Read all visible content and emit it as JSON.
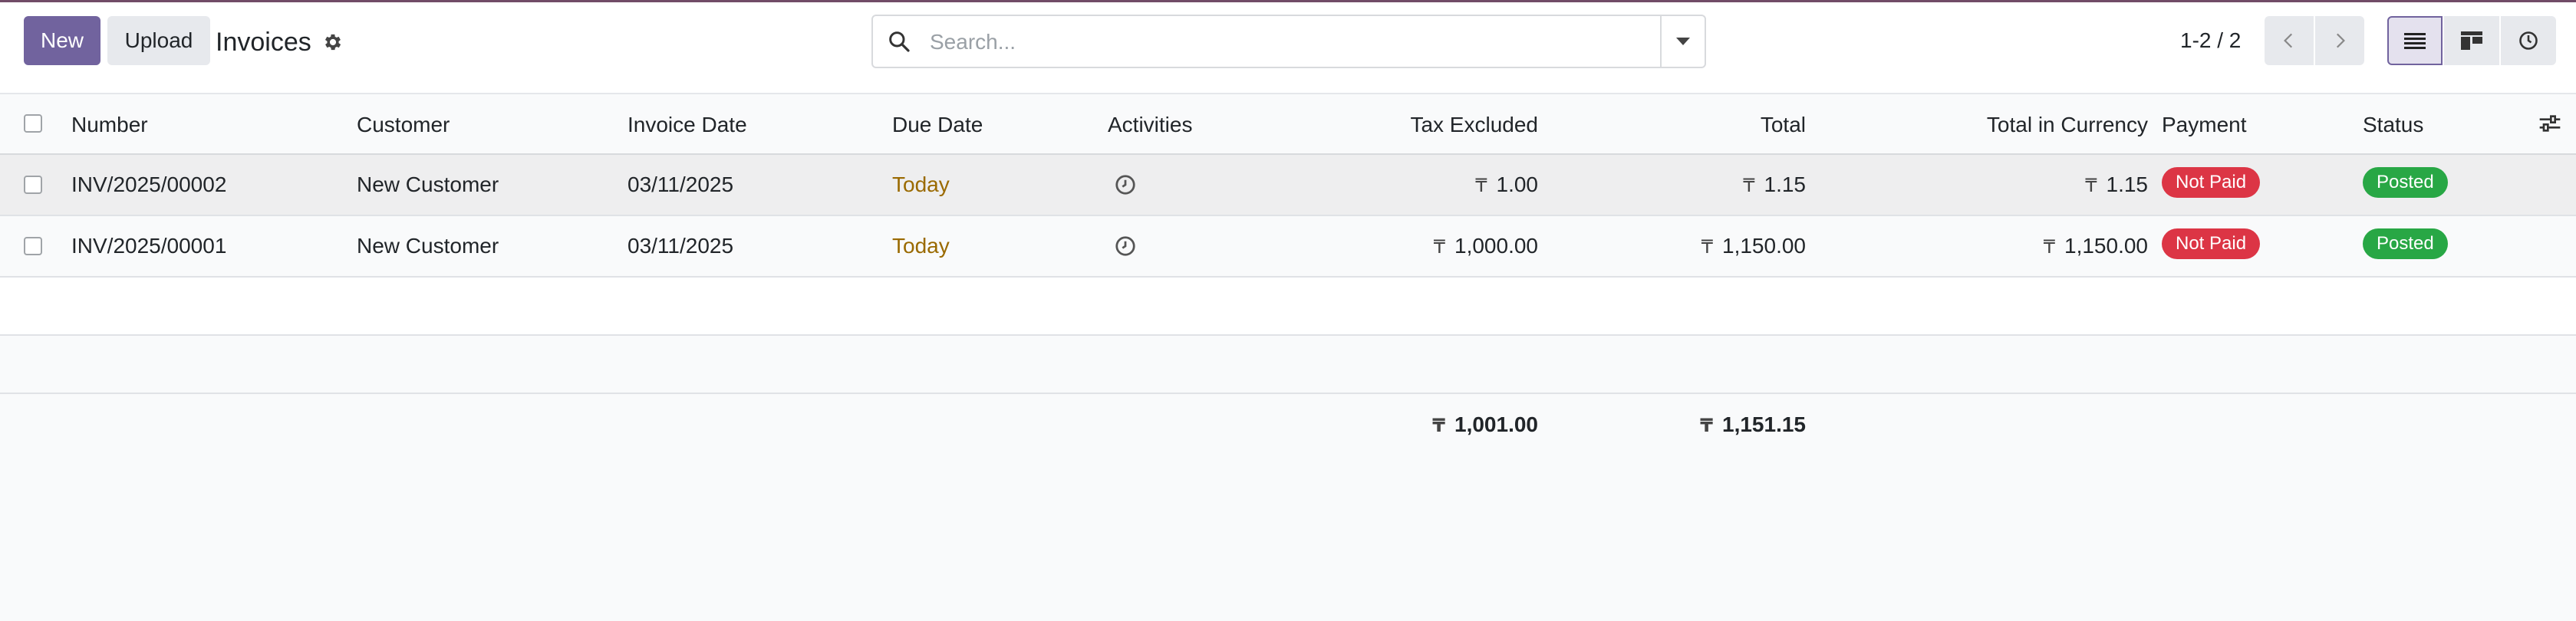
{
  "control_panel": {
    "new_label": "New",
    "upload_label": "Upload",
    "title": "Invoices",
    "search_placeholder": "Search...",
    "pager_value": "1-2 / 2"
  },
  "table": {
    "columns": {
      "number": "Number",
      "customer": "Customer",
      "invoice_date": "Invoice Date",
      "due_date": "Due Date",
      "activities": "Activities",
      "tax_excluded": "Tax Excluded",
      "total": "Total",
      "total_in_currency": "Total in Currency",
      "payment": "Payment",
      "status": "Status"
    },
    "rows": [
      {
        "number": "INV/2025/00002",
        "customer": "New Customer",
        "invoice_date": "03/11/2025",
        "due_date": "Today",
        "tax_excluded": "1.00",
        "total": "1.15",
        "total_in_currency": "1.15",
        "payment": "Not Paid",
        "status": "Posted"
      },
      {
        "number": "INV/2025/00001",
        "customer": "New Customer",
        "invoice_date": "03/11/2025",
        "due_date": "Today",
        "tax_excluded": "1,000.00",
        "total": "1,150.00",
        "total_in_currency": "1,150.00",
        "payment": "Not Paid",
        "status": "Posted"
      }
    ],
    "totals": {
      "tax_excluded": "1,001.00",
      "total": "1,151.15"
    },
    "currency_symbol": "₸"
  },
  "colors": {
    "brand": "#71639e",
    "not_paid": "#dc3545",
    "posted": "#28a745",
    "due_today": "#9a6a00"
  },
  "icons": {
    "gear": "gear-icon",
    "search": "search-icon",
    "dropdown": "caret-down-icon",
    "prev": "chevron-left-icon",
    "next": "chevron-right-icon",
    "list_view": "list-view-icon",
    "kanban_view": "kanban-view-icon",
    "activity_view": "clock-icon",
    "activity": "clock-icon",
    "optional_columns": "sliders-icon"
  }
}
